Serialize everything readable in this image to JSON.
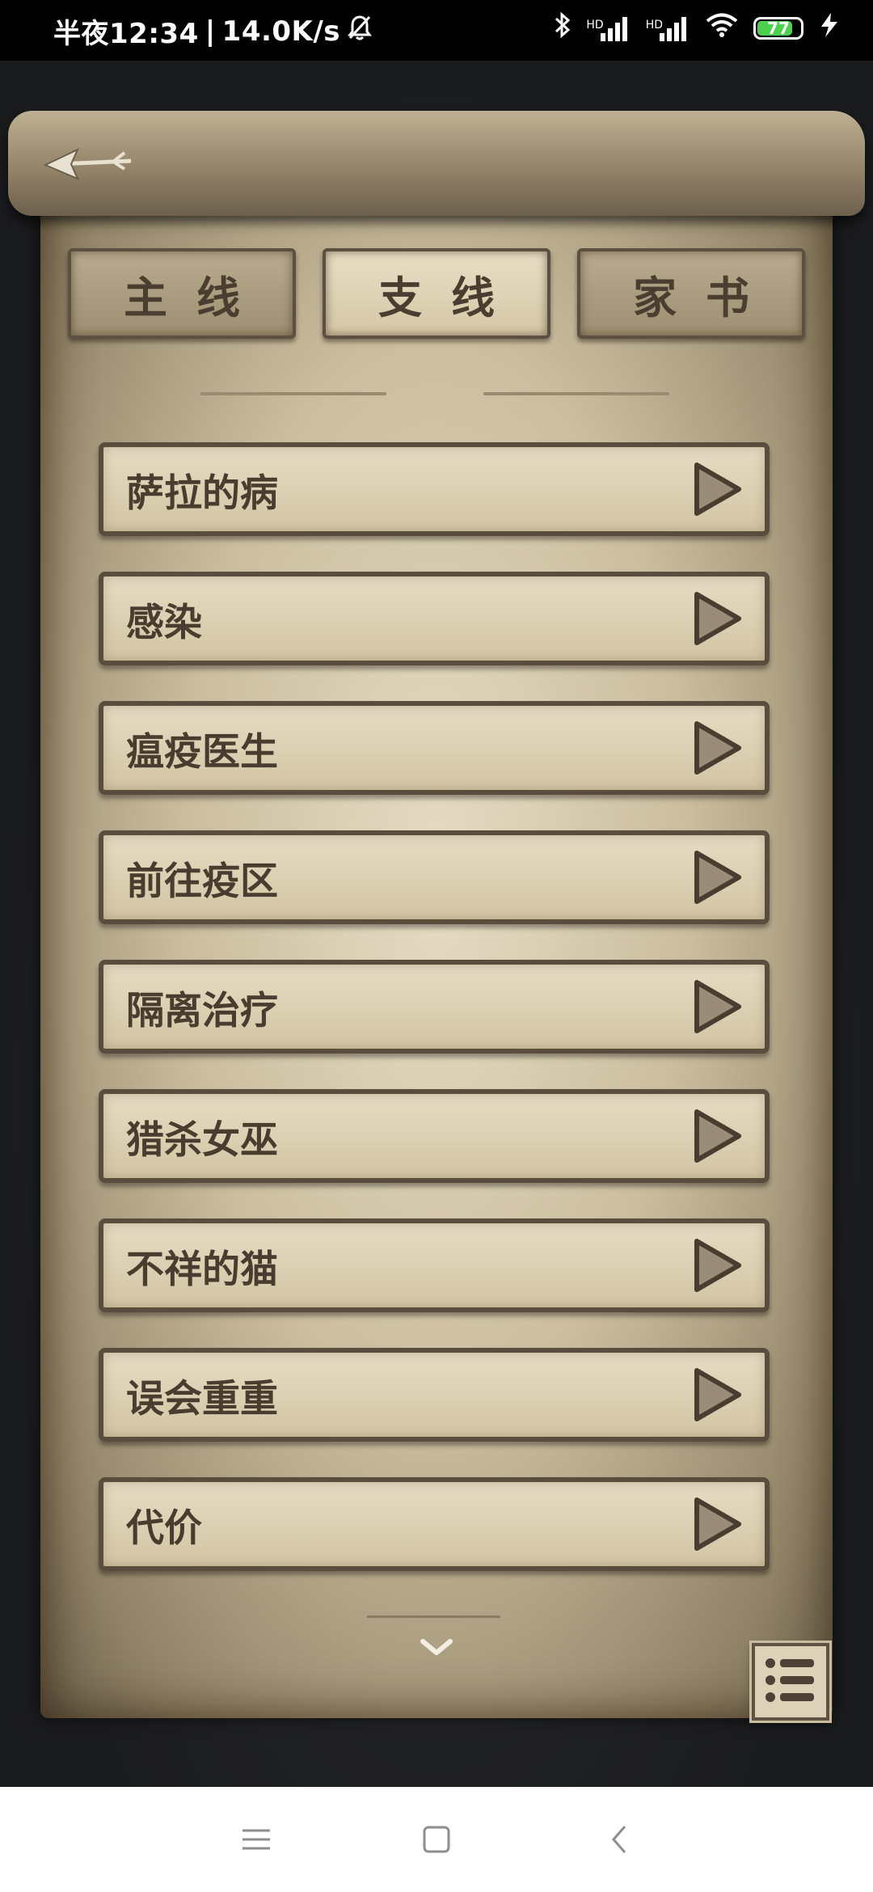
{
  "status_bar": {
    "time": "半夜12:34",
    "speed": "14.0K/s",
    "hd_label": "HD",
    "battery": "77"
  },
  "tabs": [
    {
      "label": "主线",
      "active": false
    },
    {
      "label": "支线",
      "active": true
    },
    {
      "label": "家书",
      "active": false
    }
  ],
  "quests": [
    {
      "label": "萨拉的病"
    },
    {
      "label": "感染"
    },
    {
      "label": "瘟疫医生"
    },
    {
      "label": "前往疫区"
    },
    {
      "label": "隔离治疗"
    },
    {
      "label": "猎杀女巫"
    },
    {
      "label": "不祥的猫"
    },
    {
      "label": "误会重重"
    },
    {
      "label": "代价"
    }
  ],
  "icons": {
    "back": "arrow-left-icon",
    "play": "play-triangle-icon",
    "more": "chevron-down-icon",
    "menu": "list-menu-icon"
  },
  "colors": {
    "parchment": "#d8cbb0",
    "ink": "#4a3c2f",
    "frame": "#5b4d3d",
    "battery_fill": "#4cd14e"
  }
}
